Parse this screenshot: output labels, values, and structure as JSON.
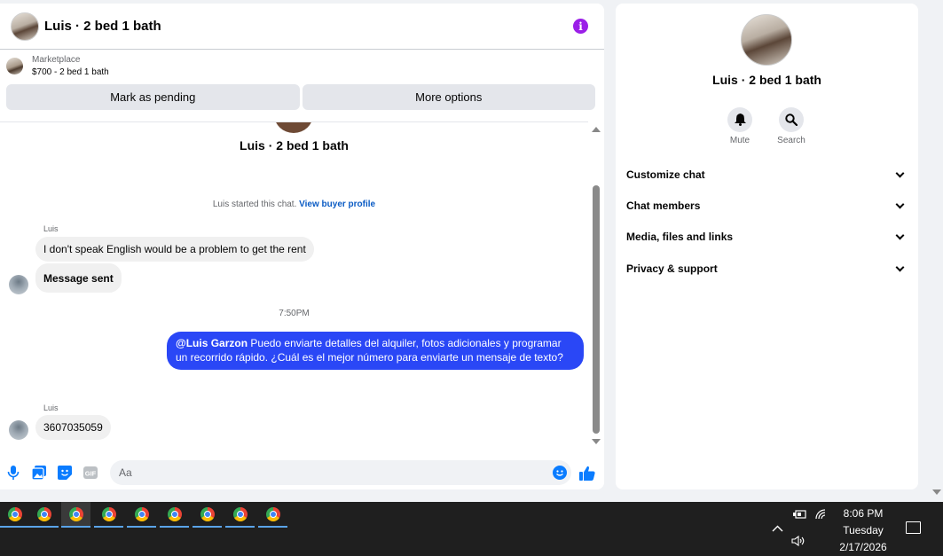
{
  "chat": {
    "title": "Luis · 2 bed 1 bath",
    "listing": {
      "source": "Marketplace",
      "price_title": "$700 - 2 bed 1 bath"
    },
    "actions": {
      "pending": "Mark as pending",
      "more": "More options"
    },
    "thread_title": "Luis · 2 bed 1 bath",
    "started_text": "Luis started this chat.",
    "started_link": "View buyer profile",
    "messages": [
      {
        "sender": "Luis",
        "text": "I don't speak English would be a problem to get the rent"
      },
      {
        "text": "Message sent"
      },
      {
        "timestamp": "7:50PM"
      },
      {
        "mention": "@Luis Garzon",
        "text": "Puedo enviarte detalles del alquiler, fotos adicionales y programar un recorrido rápido. ¿Cuál es el mejor número para enviarte un mensaje de texto?"
      },
      {
        "sender": "Luis",
        "text": "3607035059"
      }
    ],
    "composer": {
      "placeholder": "Aa"
    }
  },
  "info": {
    "title": "Luis · 2 bed 1 bath",
    "mute": "Mute",
    "search": "Search",
    "sections": [
      "Customize chat",
      "Chat members",
      "Media, files and links",
      "Privacy & support"
    ]
  },
  "taskbar": {
    "apps": [
      "chrome-icon",
      "chrome-icon",
      "chrome-icon",
      "chrome-icon",
      "chrome-icon",
      "chrome-icon",
      "chrome-icon",
      "chrome-icon",
      "chrome-icon"
    ],
    "time": "8:06 PM",
    "day": "Tuesday",
    "date": "2/17/2026"
  },
  "colors": {
    "outgoing_bubble": "#2a47f6",
    "accent": "#0a7cff",
    "info_icon": "#9b1fe8"
  }
}
